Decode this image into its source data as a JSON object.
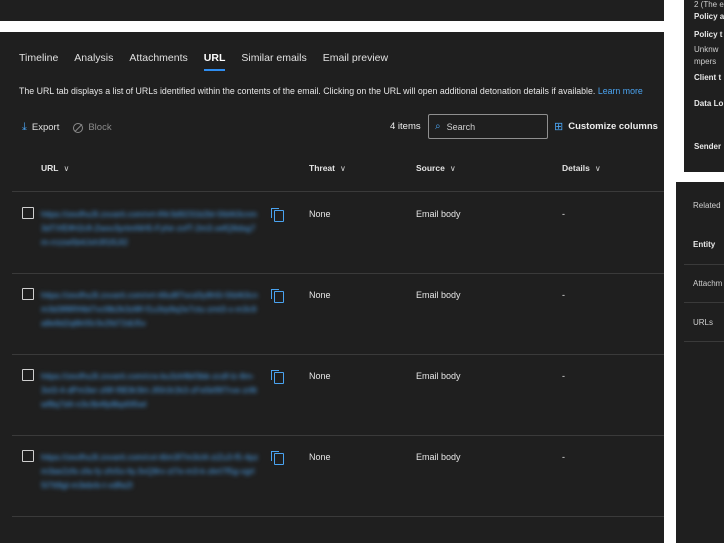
{
  "tabs": [
    {
      "label": "Timeline",
      "active": false
    },
    {
      "label": "Analysis",
      "active": false
    },
    {
      "label": "Attachments",
      "active": false
    },
    {
      "label": "URL",
      "active": true
    },
    {
      "label": "Similar emails",
      "active": false
    },
    {
      "label": "Email preview",
      "active": false
    }
  ],
  "description": "The URL tab displays a list of URLs identified within the contents of the email. Clicking on the URL will open additional detonation details if available.",
  "learn_more": "Learn more",
  "toolbar": {
    "export_label": "Export",
    "block_label": "Block",
    "items_count": "4 items",
    "search_placeholder": "Search",
    "customize_label": "Customize columns"
  },
  "table": {
    "columns": {
      "url": "URL",
      "threat": "Threat",
      "source": "Source",
      "details": "Details"
    },
    "rows": [
      {
        "url": "https://zexfhu3l.zxvarti.com/vrt-lf4r3d9231b2bl-5fd4t3cnm3dTXfDfH2cfl-Zwxv3yrtmNH5-Fyhir-zvfT-2m3.vefQ9dsg7m-rrzzw5b4Jxh3f1l5Jl2",
        "threat": "None",
        "source": "Email body",
        "details": "-"
      },
      {
        "url": "https://zexfhu3l.zxvarti.com/vrt-t6lu8f7ocd3y8h5l-5fd4t3cnm3d3lf8Rf4bl7vcl9b2k3zl8f-f1u3rp9q2e7ctu-zmt3-x-m3c9a8e9d2ql8r05r3v2fd72dlJ5v",
        "threat": "None",
        "source": "Email body",
        "details": "-"
      },
      {
        "url": "https://zexfhu3l.zxvarti.com/cra-bu3zlr8bf3bb-zcdf-lz-8m-3vt3-4-dPm3er-zl9f-f9E8r3lrt-Jl5h3r2k3-zFe5kf9f7rve-zr8twf8q7d4-n3v3b4fp8bpl0l5wl",
        "threat": "None",
        "source": "Email body",
        "details": "-"
      },
      {
        "url": "https://zexfhu3l.zxvarti.com/cvt-t6m3f7m3cl4-ziZu3-f5-4pzm3ae2zfs-zfa-fy-zfv5o-fq-3vQ9rv-zl7e-m3-k-zkrt7f5g-vgrl5l7tt9gl-m3ebrb-t-vdfla2l",
        "threat": "None",
        "source": "Email body",
        "details": "-"
      }
    ]
  },
  "right_panel_top": [
    "2 (The e",
    "Policy a",
    "Policy t",
    "Unknw",
    "mpers",
    "Client t",
    "Data Lo",
    "Sender"
  ],
  "right_panel_bottom": [
    "Related",
    "Entity",
    "Attachm",
    "URLs"
  ],
  "colors": {
    "accent": "#2f8df0",
    "link": "#4aa3f0",
    "panel_bg": "#1f1f1f"
  }
}
